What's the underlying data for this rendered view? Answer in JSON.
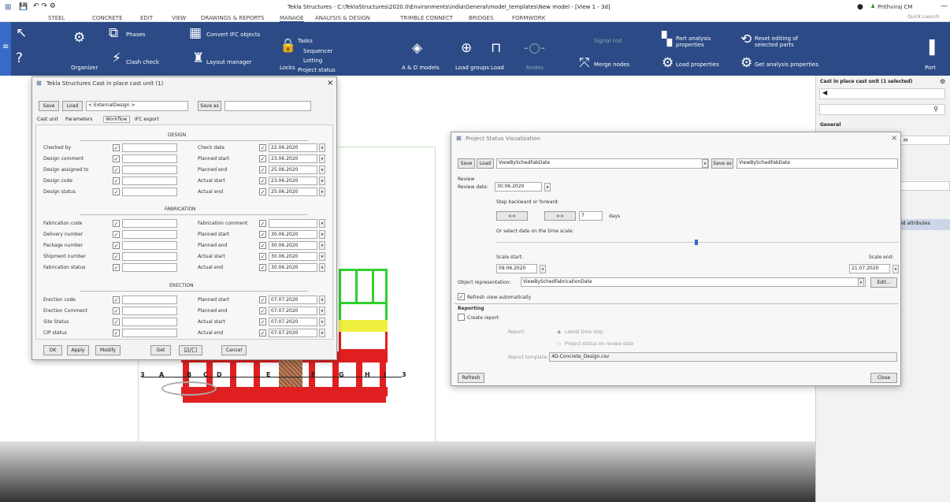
{
  "app": {
    "title": "Tekla Structures - C:\\TeklaStructures\\2020.0\\Environments\\india\\General\\model_templates\\New model - [View 1 - 3d]",
    "user": "Prithviraj CM",
    "quick_launch": "Quick Launch"
  },
  "menu_tabs": [
    "STEEL",
    "CONCRETE",
    "EDIT",
    "VIEW",
    "DRAWINGS & REPORTS",
    "MANAGE",
    "ANALYSIS & DESIGN",
    "TRIMBLE CONNECT",
    "BRIDGES",
    "FORMWORK"
  ],
  "ribbon": {
    "organizer": "Organizer",
    "phases": "Phases",
    "clash_check": "Clash check",
    "convert_ifc": "Convert IFC objects",
    "layout_manager": "Layout manager",
    "locks": "Locks",
    "tasks": "Tasks",
    "sequencer": "Sequencer",
    "lotting": "Lotting",
    "project_status": "Project status",
    "ad_models": "A & D models",
    "load_groups": "Load groups",
    "load": "Load",
    "nodes": "Nodes",
    "signal_rod": "Signal rod",
    "merge_nodes": "Merge nodes",
    "part_analysis": "Part analysis properties",
    "load_properties": "Load properties",
    "reset_editing": "Reset editing of selected parts",
    "get_analysis": "Get analysis properties",
    "port": "Port"
  },
  "cast_dialog": {
    "title": "Tekla Structures  Cast in place cast unit (1)",
    "save": "Save",
    "load": "Load",
    "design_select": "< ExternalDesign >",
    "save_as": "Save as",
    "tabs": [
      "Cast unit",
      "Parameters",
      "Workflow",
      "IFC export"
    ],
    "design_header": "DESIGN",
    "design_left": [
      "Checked by",
      "Design comment",
      "Design assigned to",
      "Design code",
      "Design status"
    ],
    "design_right": [
      {
        "label": "Check date",
        "value": "22.06.2020"
      },
      {
        "label": "Planned start",
        "value": "23.06.2020"
      },
      {
        "label": "Planned end",
        "value": "25.06.2020"
      },
      {
        "label": "Actual start",
        "value": "23.06.2020"
      },
      {
        "label": "Actual end",
        "value": "25.06.2020"
      }
    ],
    "fab_header": "FABRICATION",
    "fab_left": [
      "Fabrication code",
      "Delivery number",
      "Package number",
      "Shipment number",
      "Fabrication status"
    ],
    "fab_right": [
      {
        "label": "Fabrication comment",
        "value": ""
      },
      {
        "label": "Planned start",
        "value": "30.06.2020"
      },
      {
        "label": "Planned end",
        "value": "30.06.2020"
      },
      {
        "label": "Actual start",
        "value": "30.06.2020"
      },
      {
        "label": "Actual end",
        "value": "30.06.2020"
      }
    ],
    "erec_header": "ERECTION",
    "erec_left": [
      "Erection code",
      "Erection Comment",
      "Site Status",
      "CIP status"
    ],
    "erec_right": [
      {
        "label": "Planned start",
        "value": "07.07.2020"
      },
      {
        "label": "Planned end",
        "value": "07.07.2020"
      },
      {
        "label": "Actual start",
        "value": "07.07.2020"
      },
      {
        "label": "Actual end",
        "value": "07.07.2020"
      }
    ],
    "footer": [
      "OK",
      "Apply",
      "Modify",
      "Get",
      "☑/☐",
      "Cancel"
    ]
  },
  "psv_dialog": {
    "title": "Project Status Visualization",
    "save": "Save",
    "load": "Load",
    "preset": "ViewBySchedFabDate",
    "save_as": "Save as",
    "save_as_value": "ViewBySchedFabDate",
    "review": "Review",
    "review_date_label": "Review date:",
    "review_date": "30.06.2020",
    "step_label": "Step backward or forward:",
    "back": "<<",
    "fwd": ">>",
    "days_value": "7",
    "days": "days",
    "timescale_label": "Or select date on the time scale:",
    "scale_start_label": "Scale start:",
    "scale_end_label": "Scale end:",
    "scale_start": "09.06.2020",
    "scale_end": "21.07.2020",
    "obj_rep_label": "Object representation:",
    "obj_rep": "ViewBySchedFabricationDate",
    "edit": "Edit...",
    "refresh_auto": "Refresh view automatically",
    "reporting": "Reporting",
    "create_report": "Create report",
    "report_label": "Report:",
    "latest_step": "Latest time step",
    "project_status_review": "Project status on review date",
    "template_label": "Report template:",
    "template": "4D-Concrete_Design.csv",
    "refresh": "Refresh",
    "close": "Close"
  },
  "right_panel": {
    "header": "Cast in place cast unit (1 selected)",
    "general": "General",
    "attributes": "ed attributes",
    "value": "M"
  },
  "grid_labels": [
    "A",
    "B",
    "C",
    "D",
    "E",
    "F",
    "G",
    "H",
    "J"
  ]
}
